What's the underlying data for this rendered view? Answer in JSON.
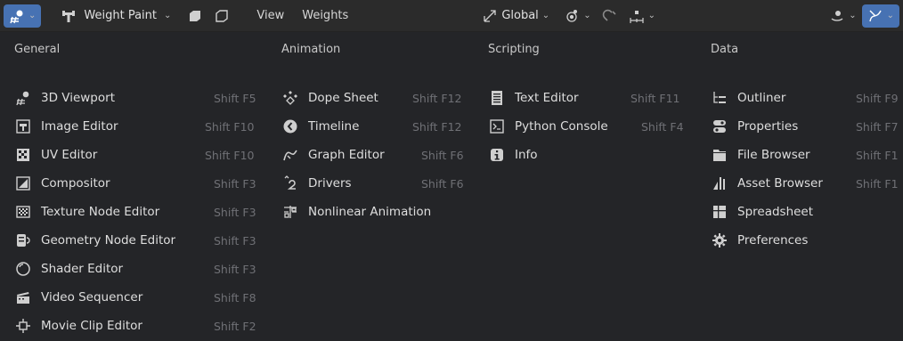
{
  "header": {
    "mode_label": "Weight Paint",
    "menu_view": "View",
    "menu_weights": "Weights",
    "transform_orientation": "Global"
  },
  "columns": [
    {
      "title": "General",
      "items": [
        {
          "label": "3D Viewport",
          "shortcut": "Shift F5",
          "icon": "3d-viewport-icon"
        },
        {
          "label": "Image Editor",
          "shortcut": "Shift F10",
          "icon": "image-editor-icon"
        },
        {
          "label": "UV Editor",
          "shortcut": "Shift F10",
          "icon": "uv-editor-icon"
        },
        {
          "label": "Compositor",
          "shortcut": "Shift F3",
          "icon": "compositor-icon"
        },
        {
          "label": "Texture Node Editor",
          "shortcut": "Shift F3",
          "icon": "texture-node-icon"
        },
        {
          "label": "Geometry Node Editor",
          "shortcut": "Shift F3",
          "icon": "geometry-node-icon"
        },
        {
          "label": "Shader Editor",
          "shortcut": "Shift F3",
          "icon": "shader-editor-icon"
        },
        {
          "label": "Video Sequencer",
          "shortcut": "Shift F8",
          "icon": "video-sequencer-icon"
        },
        {
          "label": "Movie Clip Editor",
          "shortcut": "Shift F2",
          "icon": "movie-clip-icon"
        }
      ]
    },
    {
      "title": "Animation",
      "items": [
        {
          "label": "Dope Sheet",
          "shortcut": "Shift F12",
          "icon": "dope-sheet-icon"
        },
        {
          "label": "Timeline",
          "shortcut": "Shift F12",
          "icon": "timeline-icon"
        },
        {
          "label": "Graph Editor",
          "shortcut": "Shift F6",
          "icon": "graph-editor-icon"
        },
        {
          "label": "Drivers",
          "shortcut": "Shift F6",
          "icon": "drivers-icon"
        },
        {
          "label": "Nonlinear Animation",
          "shortcut": "",
          "icon": "nla-icon"
        }
      ]
    },
    {
      "title": "Scripting",
      "items": [
        {
          "label": "Text Editor",
          "shortcut": "Shift F11",
          "icon": "text-editor-icon"
        },
        {
          "label": "Python Console",
          "shortcut": "Shift F4",
          "icon": "python-console-icon"
        },
        {
          "label": "Info",
          "shortcut": "",
          "icon": "info-icon"
        }
      ]
    },
    {
      "title": "Data",
      "items": [
        {
          "label": "Outliner",
          "shortcut": "Shift F9",
          "icon": "outliner-icon"
        },
        {
          "label": "Properties",
          "shortcut": "Shift F7",
          "icon": "properties-icon"
        },
        {
          "label": "File Browser",
          "shortcut": "Shift F1",
          "icon": "file-browser-icon"
        },
        {
          "label": "Asset Browser",
          "shortcut": "Shift F1",
          "icon": "asset-browser-icon"
        },
        {
          "label": "Spreadsheet",
          "shortcut": "",
          "icon": "spreadsheet-icon"
        },
        {
          "label": "Preferences",
          "shortcut": "",
          "icon": "preferences-icon"
        }
      ]
    }
  ]
}
